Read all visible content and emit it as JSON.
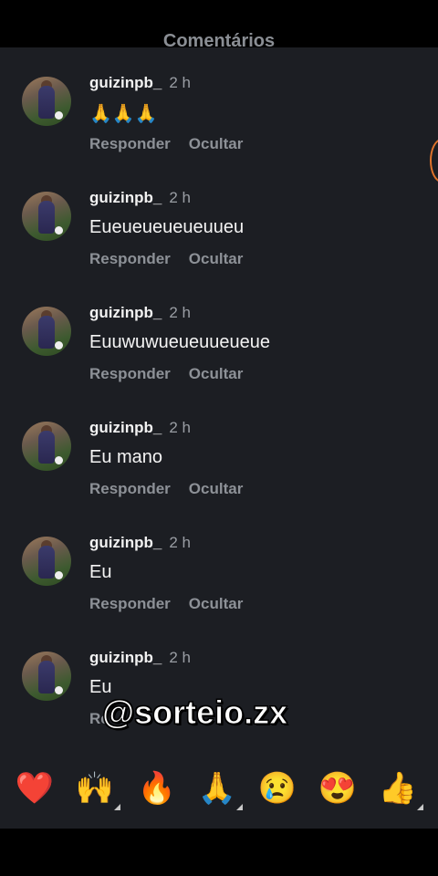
{
  "header": {
    "title": "Comentários"
  },
  "comments": [
    {
      "username": "guizinpb_",
      "time": "2 h",
      "text": "🙏🙏🙏",
      "reply": "Responder",
      "hide": "Ocultar"
    },
    {
      "username": "guizinpb_",
      "time": "2 h",
      "text": "Eueueueueueuueu",
      "reply": "Responder",
      "hide": "Ocultar"
    },
    {
      "username": "guizinpb_",
      "time": "2 h",
      "text": "Euuwuwueueuueueue",
      "reply": "Responder",
      "hide": "Ocultar"
    },
    {
      "username": "guizinpb_",
      "time": "2 h",
      "text": "Eu mano",
      "reply": "Responder",
      "hide": "Ocultar"
    },
    {
      "username": "guizinpb_",
      "time": "2 h",
      "text": "Eu",
      "reply": "Responder",
      "hide": "Ocultar"
    },
    {
      "username": "guizinpb_",
      "time": "2 h",
      "text": "Eu",
      "reply": "Re",
      "hide": ""
    }
  ],
  "overlay": {
    "watermark": "@sorteio.zx"
  },
  "reactions": [
    {
      "icon": "red-heart-icon",
      "glyph": "❤️"
    },
    {
      "icon": "raising-hands-icon",
      "glyph": "🙌"
    },
    {
      "icon": "fire-icon",
      "glyph": "🔥"
    },
    {
      "icon": "folded-hands-icon",
      "glyph": "🙏"
    },
    {
      "icon": "crying-face-icon",
      "glyph": "😢"
    },
    {
      "icon": "heart-eyes-icon",
      "glyph": "😍"
    },
    {
      "icon": "thumbs-up-icon",
      "glyph": "👍"
    }
  ],
  "colors": {
    "background": "#1c1e23",
    "text": "#f2f2f2",
    "muted": "#8d9197",
    "accent": "#e0732a"
  }
}
